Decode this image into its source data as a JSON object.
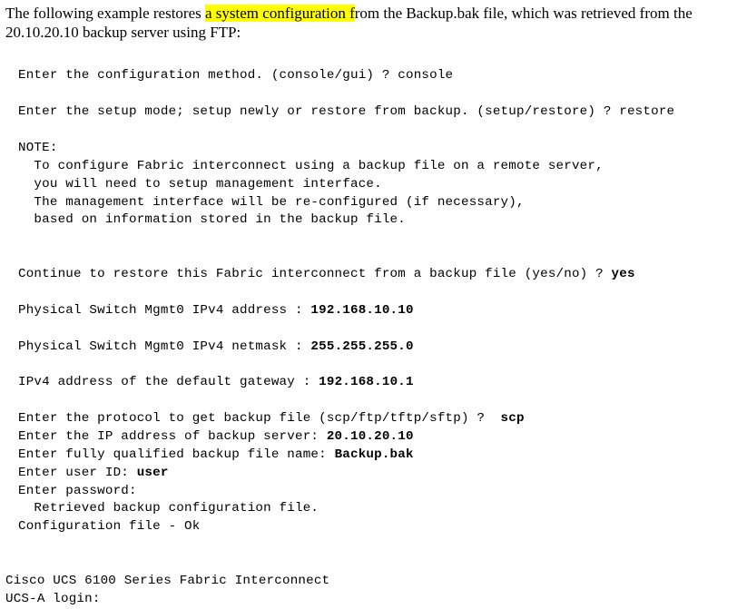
{
  "intro": {
    "pre": "The following example restores ",
    "highlighted": "a system configuration f",
    "post": "rom the Backup.bak file, which was retrieved from the 20.10.20.10 backup server using FTP:"
  },
  "lines": {
    "l1": "Enter the configuration method. (console/gui) ? console",
    "l2": "Enter the setup mode; setup newly or restore from backup. (setup/restore) ? restore",
    "noteHeader": "NOTE:",
    "note1": "  To configure Fabric interconnect using a backup file on a remote server,",
    "note2": "  you will need to setup management interface.",
    "note3": "  The management interface will be re-configured (if necessary),",
    "note4": "  based on information stored in the backup file.",
    "continuePrompt": "Continue to restore this Fabric interconnect from a backup file (yes/no) ? ",
    "continueAnswer": "yes",
    "ipAddrLabel": "Physical Switch Mgmt0 IPv4 address : ",
    "ipAddrValue": "192.168.10.10",
    "netmaskLabel": "Physical Switch Mgmt0 IPv4 netmask : ",
    "netmaskValue": "255.255.255.0",
    "gatewayLabel": "IPv4 address of the default gateway : ",
    "gatewayValue": "192.168.10.1",
    "protoPrompt": "Enter the protocol to get backup file (scp/ftp/tftp/sftp) ?  ",
    "protoAnswer": "scp",
    "serverPrompt": "Enter the IP address of backup server: ",
    "serverAnswer": "20.10.20.10",
    "fnamePrompt": "Enter fully qualified backup file name: ",
    "fnameAnswer": "Backup.bak",
    "userPrompt": "Enter user ID: ",
    "userAnswer": "user",
    "passPrompt": "Enter password:",
    "retrieved": "  Retrieved backup configuration file.",
    "ok": "Configuration file - Ok"
  },
  "footer": {
    "line1": "Cisco UCS 6100 Series Fabric Interconnect",
    "line2": "UCS-A login:"
  }
}
